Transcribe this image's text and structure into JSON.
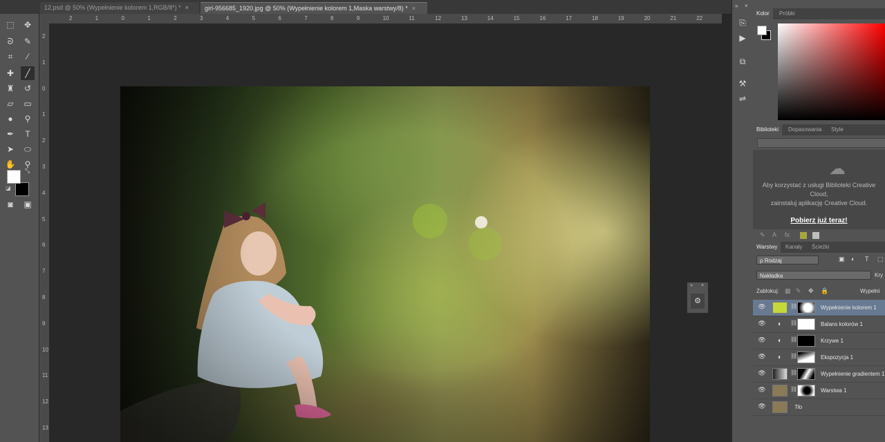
{
  "tabs": [
    {
      "label": "12.psd @ 50% (Wypełnienie kolorem 1,RGB/8*) *"
    },
    {
      "label": "girl-956685_1920.jpg @ 50% (Wypełnienie kolorem 1,Maska warstwy/8) *"
    }
  ],
  "ruler": {
    "h": [
      "2",
      "1",
      "0",
      "1",
      "2",
      "3",
      "4",
      "5",
      "6",
      "7",
      "8",
      "9",
      "10",
      "11",
      "12",
      "13",
      "14",
      "15",
      "16",
      "17",
      "18",
      "19",
      "20",
      "21",
      "22"
    ],
    "v": [
      "2",
      "1",
      "0",
      "1",
      "2",
      "3",
      "4",
      "5",
      "6",
      "7",
      "8",
      "9",
      "10",
      "11",
      "12",
      "13"
    ]
  },
  "color_panel": {
    "tabs": [
      "Kolor",
      "Próbki"
    ]
  },
  "library_panel": {
    "tabs": [
      "Biblioteki",
      "Dopasowania",
      "Style"
    ],
    "message_line1": "Aby korzystać z usługi Biblioteki Creative",
    "message_line2": "Cloud,",
    "message_line3": "zainstaluj aplikację Creative Cloud.",
    "link": "Pobierz już teraz!"
  },
  "layers_panel": {
    "tabs": [
      "Warstwy",
      "Kanały",
      "Ścieżki"
    ],
    "filter_label": "ρ Rodzaj",
    "blend_mode": "Nakładka",
    "opacity_label": "Kry",
    "lock_label": "Zablokuj:",
    "fill_label": "Wypełni",
    "layers": [
      {
        "name": "Wypełnienie kolorem 1",
        "selected": true,
        "thumb_color": "#c5d83a"
      },
      {
        "name": "Balans kolorów 1"
      },
      {
        "name": "Krzywe 1"
      },
      {
        "name": "Ekspozycja 1"
      },
      {
        "name": "Wypełnienie gradientem 1"
      },
      {
        "name": "Warstwa 1"
      },
      {
        "name": "Tło"
      }
    ]
  }
}
